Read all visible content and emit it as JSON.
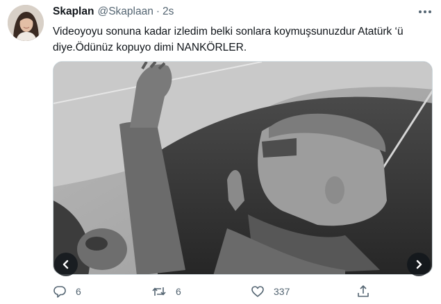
{
  "tweet": {
    "author_name": "Skaplan",
    "author_handle": "@Skaplaan",
    "separator": "·",
    "time": "2s",
    "text_line1": "Videoyoyu sonuna kadar izledim belki sonlara koymuşsunuzdur Atatürk ‘ü",
    "text_line2": "diye.Ödünüz kopuyo dimi NANKÖRLER."
  },
  "actions": {
    "reply_count": "6",
    "retweet_count": "6",
    "like_count": "337"
  },
  "icons": {
    "more": "more-dots-icon",
    "reply": "reply-icon",
    "retweet": "retweet-icon",
    "like": "heart-icon",
    "share": "share-icon",
    "prev": "chevron-left-icon",
    "next": "chevron-right-icon"
  },
  "colors": {
    "text": "#0f1419",
    "secondary": "#536471",
    "border": "#cfd9de"
  }
}
